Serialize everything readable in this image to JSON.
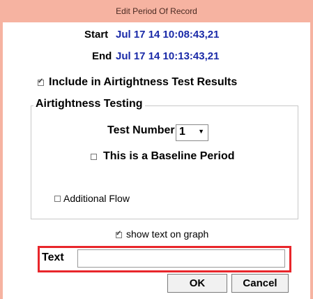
{
  "window": {
    "title": "Edit Period Of Record",
    "accent_color": "#f6b3a1"
  },
  "period": {
    "start_label": "Start",
    "start_value": "Jul 17 14 10:08:43,21",
    "end_label": "End",
    "end_value": "Jul 17 14 10:13:43,21",
    "value_color": "#1a2aa8"
  },
  "include_airtightness": {
    "label": "Include in Airtightness Test Results",
    "checked": true
  },
  "airtightness_group": {
    "title": "Airtightness Testing",
    "test_number_label": "Test Number",
    "test_number_value": "1",
    "baseline": {
      "label": "This is a Baseline Period",
      "checked": false
    },
    "additional_flow": {
      "label": "Additional Flow",
      "checked": false
    }
  },
  "show_text_on_graph": {
    "label": "show text on graph",
    "checked": true
  },
  "text_field": {
    "label": "Text",
    "value": "",
    "highlight_color": "#e8262b"
  },
  "buttons": {
    "ok_label": "OK",
    "cancel_label": "Cancel"
  }
}
